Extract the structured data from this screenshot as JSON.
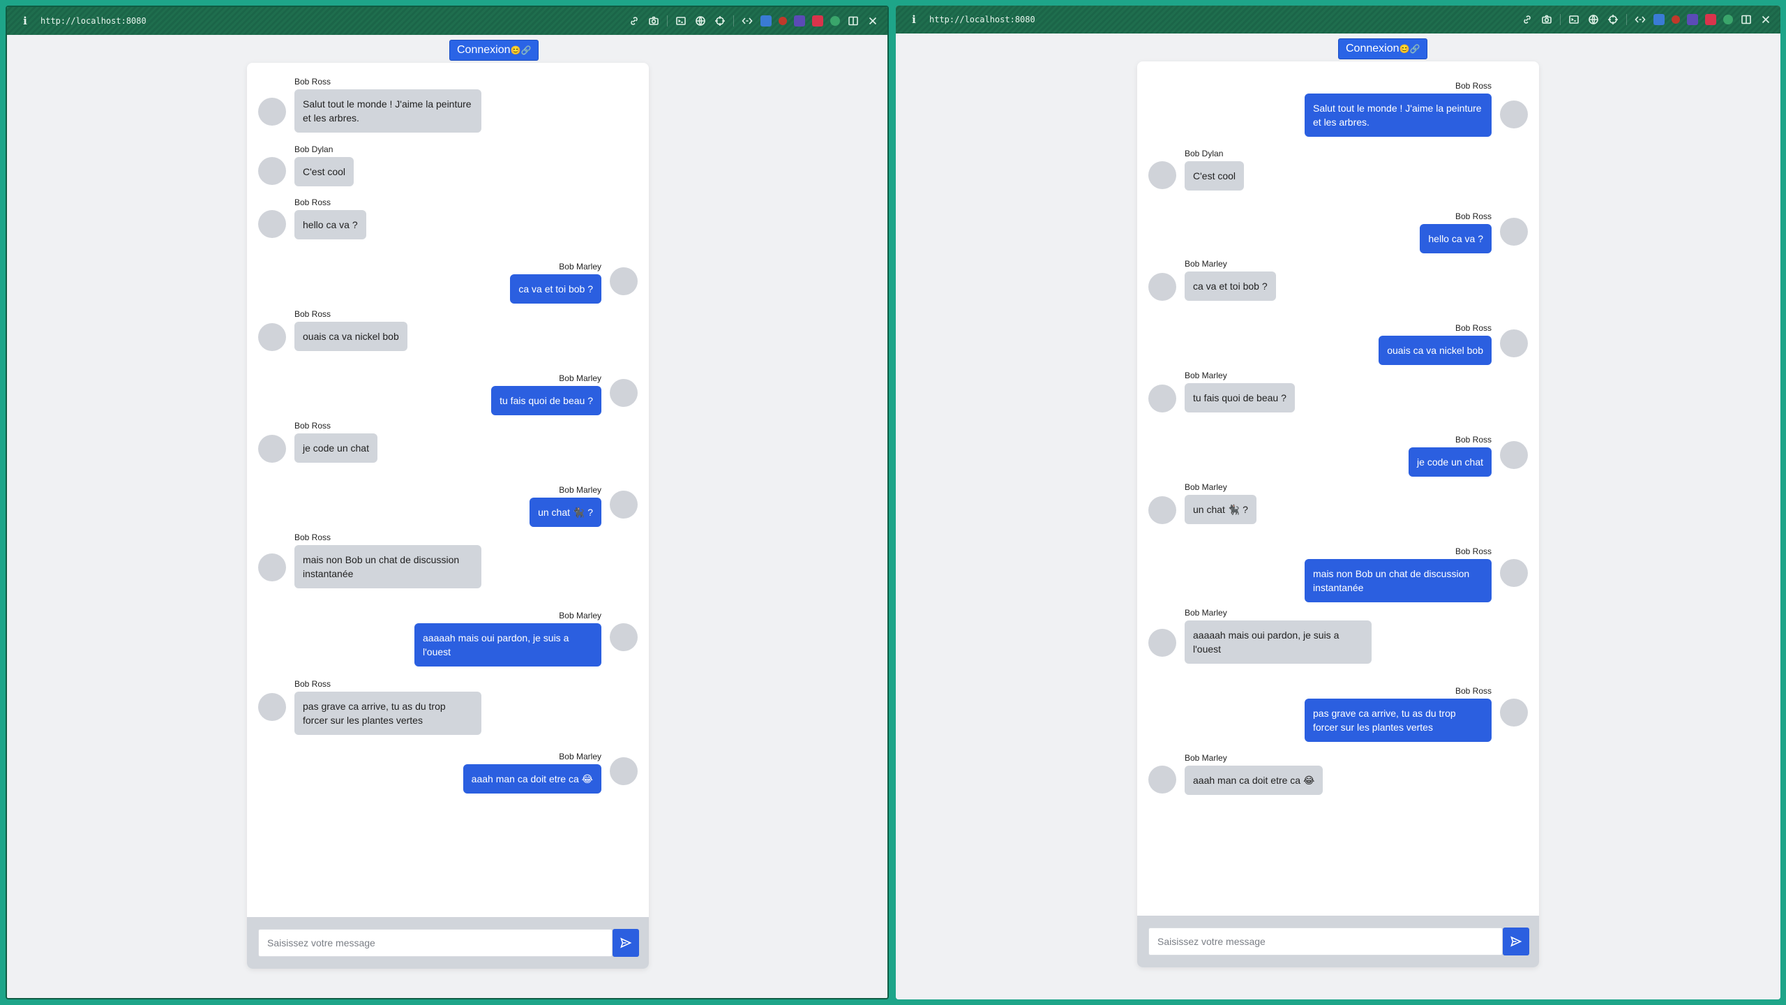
{
  "colors": {
    "desktop_bg": "#1ea589",
    "titlebar_bg": "#1f6e4e",
    "accent_blue": "#2b5fe0",
    "incoming_bubble": "#d1d5db",
    "avatar": "#d0d3d9",
    "page_bg": "#f0f1f3"
  },
  "left_window": {
    "url": "http://localhost:8080",
    "login_label": "Connexion",
    "login_emoji": "😊🔗",
    "messages": [
      {
        "author": "Bob Ross",
        "text": "Salut tout le monde ! J'aime la peinture et les arbres.",
        "direction": "in"
      },
      {
        "author": "Bob Dylan",
        "text": "C'est cool",
        "direction": "in"
      },
      {
        "author": "Bob Ross",
        "text": "hello ca va ?",
        "direction": "in"
      },
      {
        "author": "Bob Marley",
        "text": "ca va et toi bob ?",
        "direction": "out"
      },
      {
        "author": "Bob Ross",
        "text": "ouais ca va nickel bob",
        "direction": "in"
      },
      {
        "author": "Bob Marley",
        "text": "tu fais quoi de beau ?",
        "direction": "out"
      },
      {
        "author": "Bob Ross",
        "text": "je code un chat",
        "direction": "in"
      },
      {
        "author": "Bob Marley",
        "text": "un chat 🐈‍⬛ ?",
        "direction": "out"
      },
      {
        "author": "Bob Ross",
        "text": "mais non Bob un chat de discussion instantanée",
        "direction": "in"
      },
      {
        "author": "Bob Marley",
        "text": "aaaaah mais oui pardon, je suis a l'ouest",
        "direction": "out"
      },
      {
        "author": "Bob Ross",
        "text": "pas grave ca arrive, tu as du trop forcer sur les plantes vertes",
        "direction": "in"
      },
      {
        "author": "Bob Marley",
        "text": "aaah man ca doit etre ca 😂",
        "direction": "out"
      }
    ],
    "composer_placeholder": "Saisissez votre message"
  },
  "right_window": {
    "url": "http://localhost:8080",
    "login_label": "Connexion",
    "login_emoji": "😊🔗",
    "messages": [
      {
        "author": "Bob Ross",
        "text": "Salut tout le monde ! J'aime la peinture et les arbres.",
        "direction": "out"
      },
      {
        "author": "Bob Dylan",
        "text": "C'est cool",
        "direction": "in"
      },
      {
        "author": "Bob Ross",
        "text": "hello ca va ?",
        "direction": "out"
      },
      {
        "author": "Bob Marley",
        "text": "ca va et toi bob ?",
        "direction": "in"
      },
      {
        "author": "Bob Ross",
        "text": "ouais ca va nickel bob",
        "direction": "out"
      },
      {
        "author": "Bob Marley",
        "text": "tu fais quoi de beau ?",
        "direction": "in"
      },
      {
        "author": "Bob Ross",
        "text": "je code un chat",
        "direction": "out"
      },
      {
        "author": "Bob Marley",
        "text": "un chat 🐈‍⬛ ?",
        "direction": "in"
      },
      {
        "author": "Bob Ross",
        "text": "mais non Bob un chat de discussion instantanée",
        "direction": "out"
      },
      {
        "author": "Bob Marley",
        "text": "aaaaah mais oui pardon, je suis a l'ouest",
        "direction": "in"
      },
      {
        "author": "Bob Ross",
        "text": "pas grave ca arrive, tu as du trop forcer sur les plantes vertes",
        "direction": "out"
      },
      {
        "author": "Bob Marley",
        "text": "aaah man ca doit etre ca 😂",
        "direction": "in"
      }
    ],
    "composer_placeholder": "Saisissez votre message"
  },
  "toolbar_icons": [
    "link-icon",
    "camera-icon",
    "terminal-icon",
    "globe-icon",
    "crosshair-icon",
    "code-icon",
    "extension-icon",
    "extension-icon",
    "extension-icon",
    "extension-icon",
    "extension-icon",
    "split-view-icon",
    "close-icon"
  ]
}
